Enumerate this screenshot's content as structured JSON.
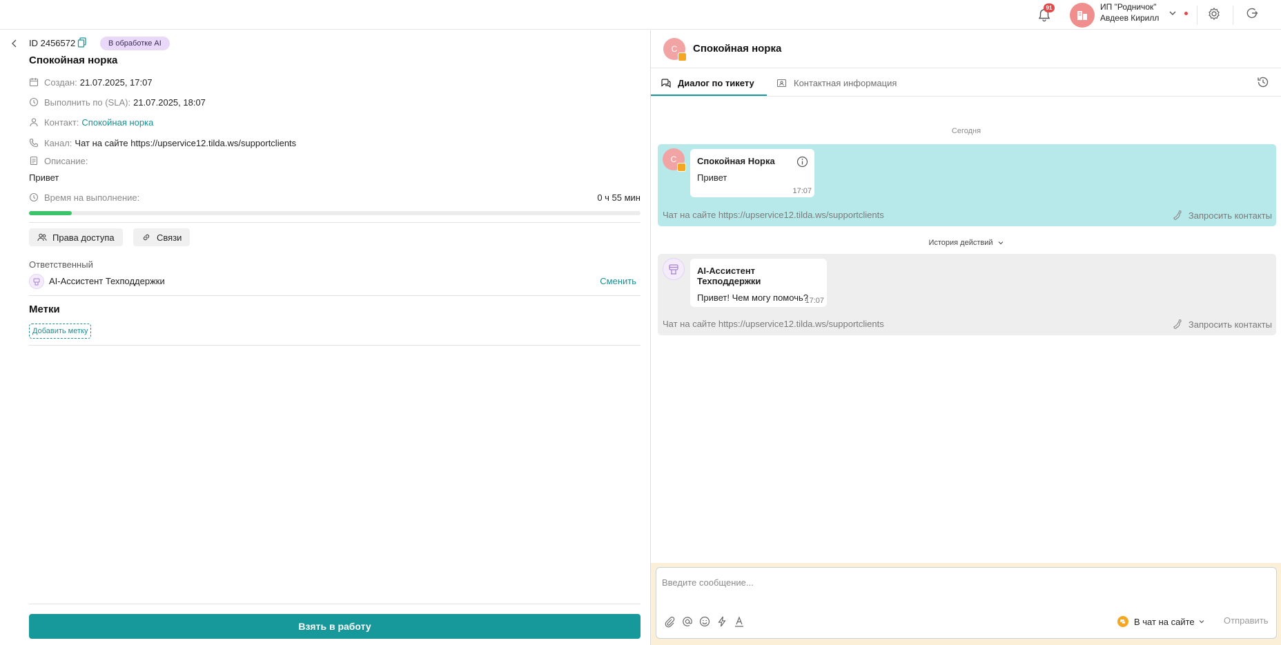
{
  "header": {
    "notifications_count": "91",
    "company": "ИП \"Родничок\"",
    "user": "Авдеев Кирилл"
  },
  "ticket": {
    "id": "ID 2456572",
    "status": "В обработке AI",
    "title": "Спокойная норка",
    "created_label": "Создан:",
    "created_value": "21.07.2025, 17:07",
    "due_label": "Выполнить по (SLA):",
    "due_value": "21.07.2025, 18:07",
    "contact_label": "Контакт:",
    "contact_value": "Спокойная норка",
    "channel_label": "Канал:",
    "channel_value": "Чат на сайте https://upservice12.tilda.ws/supportclients",
    "description_label": "Описание:",
    "description_value": "Привет",
    "time_label": "Время на выполнение:",
    "time_value": "0 ч 55 мин",
    "time_progress": 0.07,
    "access_button": "Права доступа",
    "links_button": "Связи",
    "responsible_label": "Ответственный",
    "responsible_name": "AI-Ассистент Техподдержки",
    "change_button": "Сменить",
    "tags_title": "Метки",
    "add_tag_button": "Добавить метку",
    "take_button": "Взять в работу"
  },
  "chat": {
    "avatar_letter": "С",
    "title": "Спокойная норка",
    "tabs": [
      {
        "label": "Диалог по тикету",
        "active": true
      },
      {
        "label": "Контактная информация",
        "active": false
      }
    ],
    "day_separator": "Сегодня",
    "messages": [
      {
        "avatar_letter": "С",
        "author": "Спокойная Норка",
        "text": "Привет",
        "time": "17:07",
        "channel": "Чат на сайте https://upservice12.tilda.ws/supportclients",
        "request_contacts": "Запросить контакты"
      },
      {
        "author": "AI-Ассистент Техподдержки",
        "text": "Привет! Чем могу помочь?",
        "time": "17:07",
        "channel": "Чат на сайте https://upservice12.tilda.ws/supportclients",
        "request_contacts": "Запросить контакты"
      }
    ],
    "history_toggle": "История действий",
    "composer": {
      "placeholder": "Введите сообщение...",
      "channel": "В чат на сайте",
      "send": "Отправить"
    }
  },
  "colors": {
    "accent": "#17989a",
    "client_bubble_bg": "#b8e9ea",
    "ai_badge_bg": "#e9d8f7",
    "progress": "#3cc46a"
  }
}
